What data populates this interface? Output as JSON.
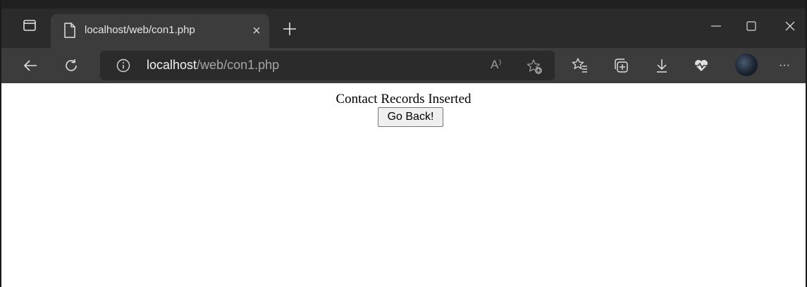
{
  "tab": {
    "title": "localhost/web/con1.php",
    "close_label": "×"
  },
  "address": {
    "host": "localhost",
    "path": "/web/con1.php"
  },
  "toolbar": {
    "read_aloud_label": "A⁾",
    "more_label": "···"
  },
  "page": {
    "message": "Contact Records Inserted",
    "back_button_label": "Go Back!"
  },
  "colors": {
    "tabstrip": "#202020",
    "active_tab": "#3c3c3c",
    "toolbar": "#3c3c3c",
    "addressbar": "#2b2b2b",
    "page_background": "#ffffff"
  }
}
